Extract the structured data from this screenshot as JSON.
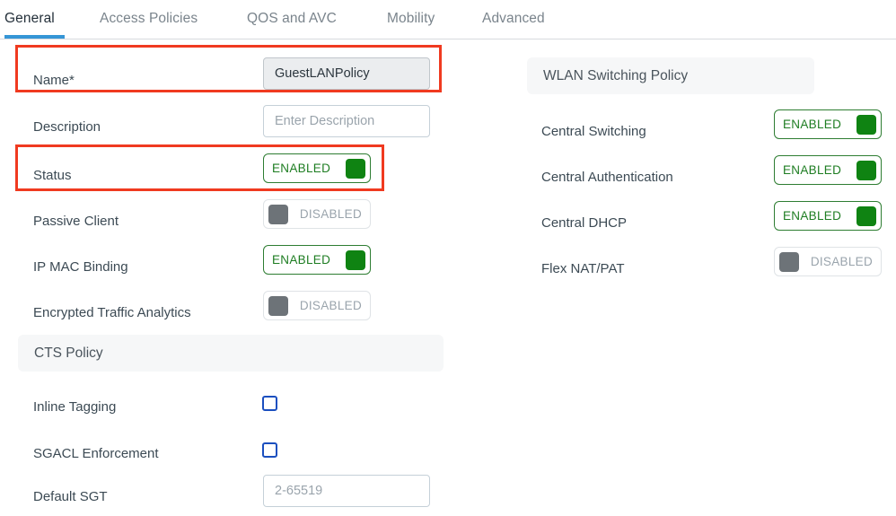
{
  "tabs": [
    {
      "label": "General",
      "active": true
    },
    {
      "label": "Access Policies",
      "active": false
    },
    {
      "label": "QOS and AVC",
      "active": false
    },
    {
      "label": "Mobility",
      "active": false
    },
    {
      "label": "Advanced",
      "active": false
    }
  ],
  "left": {
    "fields": [
      {
        "label": "Name*",
        "type": "text",
        "value": "GuestLANPolicy",
        "placeholder": ""
      },
      {
        "label": "Description",
        "type": "text",
        "value": "",
        "placeholder": "Enter Description"
      },
      {
        "label": "Status",
        "type": "toggle",
        "state": "ENABLED"
      },
      {
        "label": "Passive Client",
        "type": "toggle",
        "state": "DISABLED"
      },
      {
        "label": "IP MAC Binding",
        "type": "toggle",
        "state": "ENABLED"
      },
      {
        "label": "Encrypted Traffic Analytics",
        "type": "toggle",
        "state": "DISABLED"
      }
    ],
    "cts_section": {
      "title": "CTS Policy",
      "rows": [
        {
          "label": "Inline Tagging",
          "type": "checkbox",
          "checked": false
        },
        {
          "label": "SGACL Enforcement",
          "type": "checkbox",
          "checked": false
        },
        {
          "label": "Default SGT",
          "type": "text",
          "value": "",
          "placeholder": "2-65519"
        }
      ]
    }
  },
  "right": {
    "wlan_section": {
      "title": "WLAN Switching Policy",
      "rows": [
        {
          "label": "Central Switching",
          "state": "ENABLED"
        },
        {
          "label": "Central Authentication",
          "state": "ENABLED"
        },
        {
          "label": "Central DHCP",
          "state": "ENABLED"
        },
        {
          "label": "Flex NAT/PAT",
          "state": "DISABLED"
        }
      ]
    }
  },
  "annotations": [
    {
      "name": "name-field-highlight",
      "label": "Name* row highlight"
    },
    {
      "name": "status-field-highlight",
      "label": "Status row highlight"
    }
  ],
  "colors": {
    "accent_tab": "#3596d6",
    "toggle_on": "#0f8312",
    "toggle_off": "#6d7378",
    "annotation": "#f03a20",
    "checkbox": "#1b4fbf",
    "section_bg": "#f6f7f8"
  }
}
